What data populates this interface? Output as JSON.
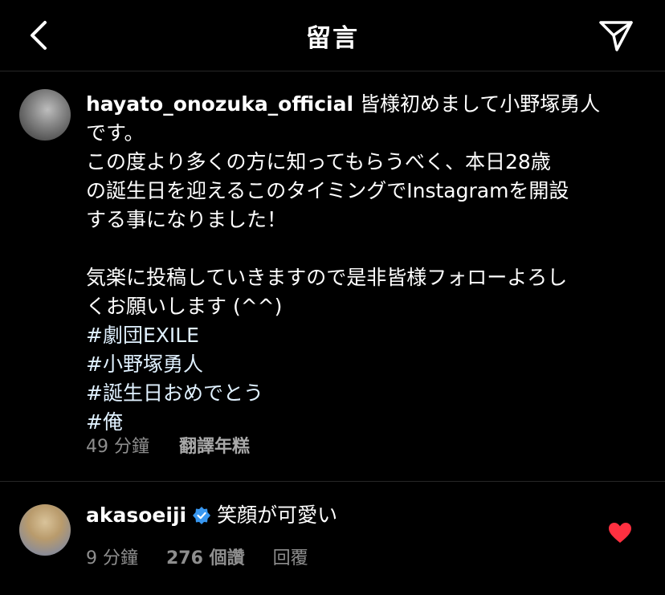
{
  "header": {
    "title": "留言",
    "back_icon": "chevron-left-icon",
    "send_icon": "paper-plane-icon"
  },
  "post": {
    "username": "hayato_onozuka_official",
    "lines": [
      " 皆様初めまして小野塚勇人",
      "です。",
      "この度より多くの方に知ってもらうべく、本日28歳",
      "の誕生日を迎えるこのタイミングでInstagramを開設",
      "する事になりました！",
      "",
      "気楽に投稿していきますので是非皆様フォローよろし",
      "くお願いします (^^)"
    ],
    "hashtags": [
      "#劇団EXILE",
      "#小野塚勇人",
      "#誕生日おめでとう",
      "#俺"
    ],
    "time": "49 分鐘",
    "translate": "翻譯年糕"
  },
  "comment": {
    "username": "akasoeiji",
    "text": "笑顔が可愛い",
    "time": "9 分鐘",
    "likes": "276 個讚",
    "reply": "回覆",
    "heart_color": "#ff3040",
    "verified_color": "#3897f0"
  }
}
